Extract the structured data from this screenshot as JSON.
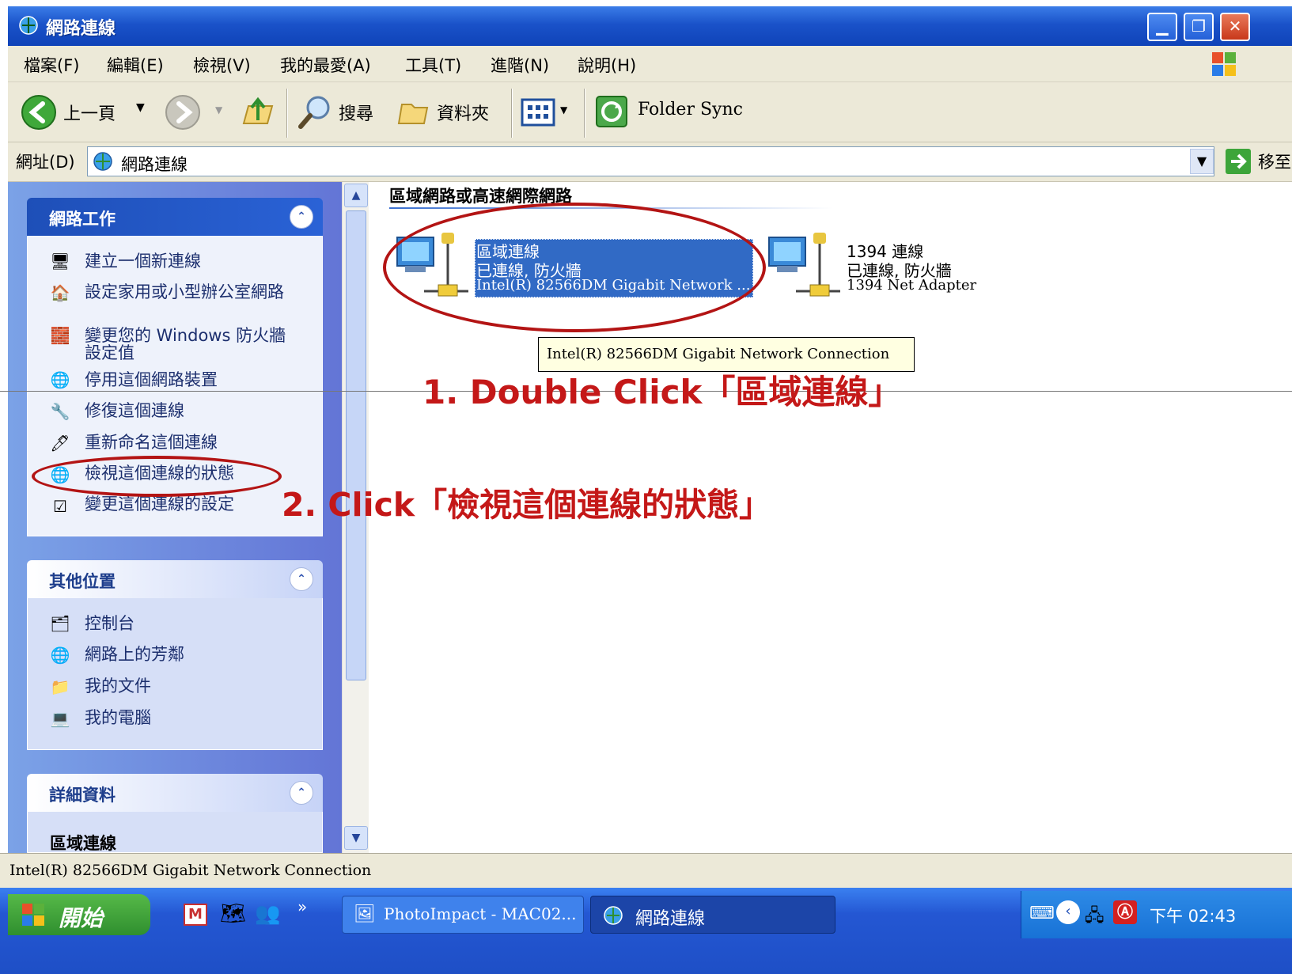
{
  "window": {
    "title": "網路連線",
    "minimize_label": "▁",
    "restore_label": "❐",
    "close_label": "✕"
  },
  "menu": [
    "檔案(F)",
    "編輯(E)",
    "檢視(V)",
    "我的最愛(A)",
    "工具(T)",
    "進階(N)",
    "說明(H)"
  ],
  "toolbar": {
    "back_label": "上一頁",
    "search_label": "搜尋",
    "folders_label": "資料夾",
    "folder_sync_label": "Folder Sync"
  },
  "address": {
    "label": "網址(D)",
    "value": "網路連線",
    "go_label": "移至"
  },
  "left_pane": {
    "network_tasks": {
      "title": "網路工作",
      "items": [
        "建立一個新連線",
        "設定家用或小型辦公室網路",
        "變更您的 Windows 防火牆設定值",
        "停用這個網路裝置",
        "修復這個連線",
        "重新命名這個連線",
        "檢視這個連線的狀態",
        "變更這個連線的設定"
      ]
    },
    "other_places": {
      "title": "其他位置",
      "items": [
        "控制台",
        "網路上的芳鄰",
        "我的文件",
        "我的電腦"
      ]
    },
    "details": {
      "title": "詳細資料",
      "name": "區域連線"
    }
  },
  "content": {
    "group_header": "區域網路或高速網際網路",
    "connections": [
      {
        "name": "區域連線",
        "status": "已連線, 防火牆",
        "device": "Intel(R) 82566DM Gigabit Network ..."
      },
      {
        "name": "1394 連線",
        "status": "已連線, 防火牆",
        "device": "1394 Net Adapter"
      }
    ],
    "tooltip": "Intel(R) 82566DM Gigabit Network Connection"
  },
  "annotations": {
    "step1": "1. Double Click「區域連線」",
    "step2": "2. Click「檢視這個連線的狀態」"
  },
  "statusbar": {
    "text": "Intel(R) 82566DM Gigabit Network Connection"
  },
  "taskbar": {
    "start_label": "開始",
    "items": [
      "PhotoImpact - MAC02...",
      "網路連線"
    ],
    "clock": "下午 02:43"
  },
  "colors": {
    "titlebar": "#1a52c9",
    "annotation_red": "#c41818",
    "selection": "#316ac5"
  }
}
